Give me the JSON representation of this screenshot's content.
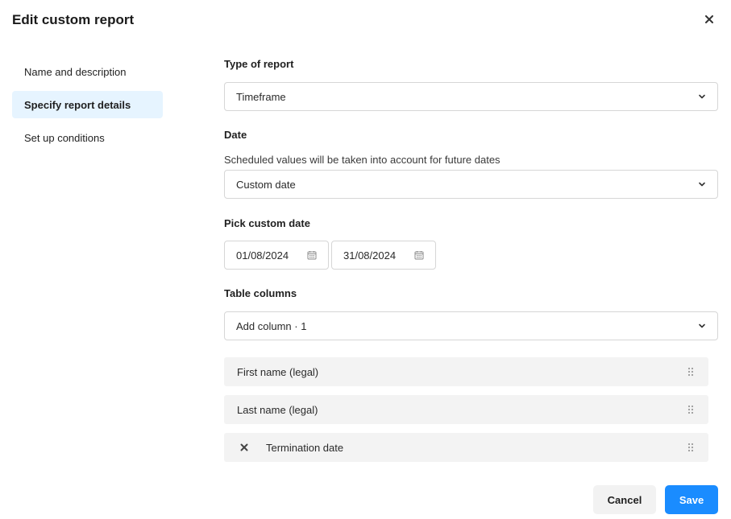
{
  "dialog": {
    "title": "Edit custom report",
    "close_icon": "close-icon"
  },
  "sidebar": {
    "items": [
      {
        "label": "Name and description",
        "active": false
      },
      {
        "label": "Specify report details",
        "active": true
      },
      {
        "label": "Set up conditions",
        "active": false
      }
    ]
  },
  "form": {
    "type_label": "Type of report",
    "type_value": "Timeframe",
    "date_label": "Date",
    "date_help": "Scheduled values will be taken into account for future dates",
    "date_value": "Custom date",
    "custom_date_label": "Pick custom date",
    "start_date": "01/08/2024",
    "end_date": "31/08/2024",
    "columns_label": "Table columns",
    "add_column": "Add column · 1",
    "columns": [
      {
        "label": "First name (legal)",
        "removable": false
      },
      {
        "label": "Last name (legal)",
        "removable": false
      },
      {
        "label": "Termination date",
        "removable": true
      }
    ]
  },
  "footer": {
    "cancel_label": "Cancel",
    "save_label": "Save"
  },
  "colors": {
    "accent": "#1a8cff",
    "active_nav_bg": "#e6f4ff",
    "column_bg": "#f3f3f3"
  }
}
